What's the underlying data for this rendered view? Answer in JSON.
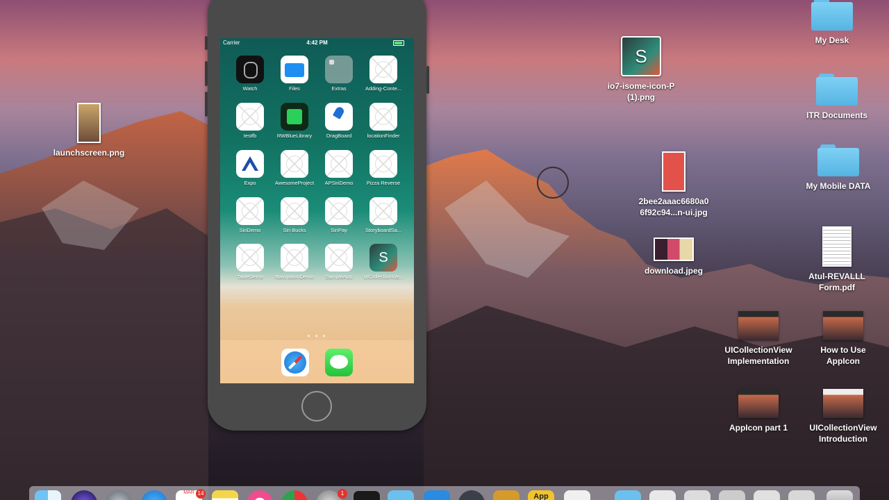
{
  "desktop": {
    "icons": [
      {
        "label": "launchscreen.png",
        "type": "image"
      },
      {
        "label": "io7-isome-icon-P\n(1).png",
        "type": "image"
      },
      {
        "label": "2bee2aaac6680a0\n6f92c94...n-ui.jpg",
        "type": "image"
      },
      {
        "label": "download.jpeg",
        "type": "image"
      },
      {
        "label": "My Desk",
        "type": "folder"
      },
      {
        "label": "ITR Documents",
        "type": "folder"
      },
      {
        "label": "My Mobile DATA",
        "type": "folder"
      },
      {
        "label": "Atul-REVALLL\nForm.pdf",
        "type": "document"
      },
      {
        "label": "UICollectionView\nImplementation",
        "type": "video"
      },
      {
        "label": "How to Use\nAppIcon",
        "type": "video"
      },
      {
        "label": "AppIcon part 1",
        "type": "video"
      },
      {
        "label": "UICollectionView\nIntroduction",
        "type": "video"
      }
    ]
  },
  "simulator": {
    "status_bar": {
      "carrier": "Carrier",
      "time": "4:42 PM"
    },
    "apps": [
      {
        "label": "Watch",
        "icon": "watch-icon"
      },
      {
        "label": "Files",
        "icon": "files-icon"
      },
      {
        "label": "Extras",
        "icon": "folder-icon"
      },
      {
        "label": "Adding-Conte...",
        "icon": "blank-app-icon"
      },
      {
        "label": "testfb",
        "icon": "blank-app-icon"
      },
      {
        "label": "RWBlueLibrary",
        "icon": "rw-icon"
      },
      {
        "label": "DragBoard",
        "icon": "pin-icon"
      },
      {
        "label": "locationFinder",
        "icon": "blank-app-icon"
      },
      {
        "label": "Expo",
        "icon": "expo-icon"
      },
      {
        "label": "AwesomeProject",
        "icon": "blank-app-icon"
      },
      {
        "label": "APSiriDemo",
        "icon": "blank-app-icon"
      },
      {
        "label": "Pizza Reverse",
        "icon": "blank-app-icon"
      },
      {
        "label": "SiriDemo",
        "icon": "blank-app-icon"
      },
      {
        "label": "Siri Bucks",
        "icon": "blank-app-icon"
      },
      {
        "label": "SiriPay",
        "icon": "blank-app-icon"
      },
      {
        "label": "StoryboardSa...",
        "icon": "blank-app-icon"
      },
      {
        "label": "TableDemo",
        "icon": "blank-app-icon"
      },
      {
        "label": "NavigationDemo",
        "icon": "blank-app-icon"
      },
      {
        "label": "SampleApp",
        "icon": "blank-app-icon"
      },
      {
        "label": "UICollectionVie...",
        "icon": "s-app-icon"
      }
    ],
    "page_dots": "● ● ●",
    "dock": [
      {
        "name": "Safari",
        "icon": "safari-icon"
      },
      {
        "name": "Messages",
        "icon": "messages-icon"
      }
    ]
  },
  "macdock": {
    "calendar": {
      "month": "MAR",
      "day": "14"
    },
    "badge": "1",
    "app_label": "App"
  }
}
